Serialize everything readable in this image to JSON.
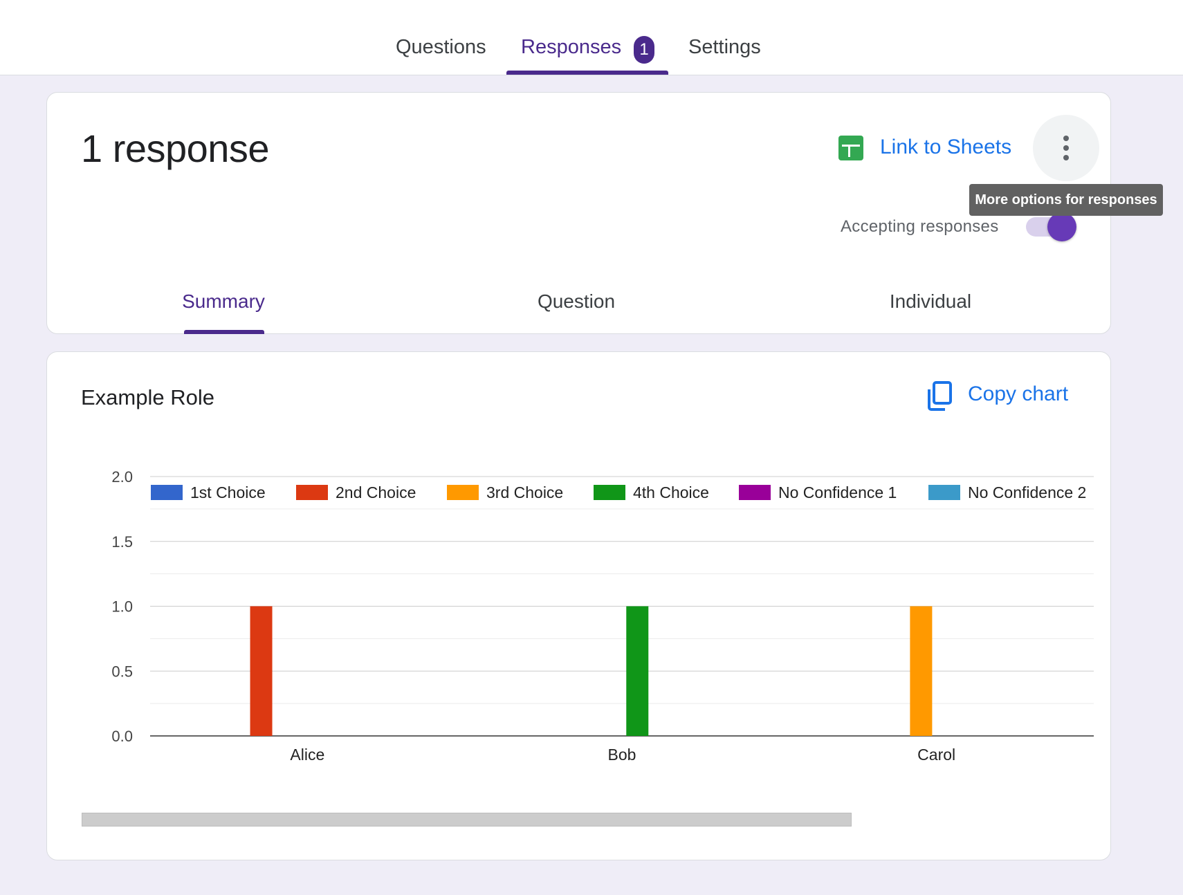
{
  "top_tabs": [
    {
      "label": "Questions"
    },
    {
      "label": "Responses",
      "badge": "1"
    },
    {
      "label": "Settings"
    }
  ],
  "summary": {
    "title": "1 response",
    "link_sheets": "Link to Sheets",
    "more_icon": "more-vert-icon",
    "tooltip": "More options for responses",
    "accepting_label": "Accepting responses",
    "accepting_on": true,
    "sub_tabs": [
      {
        "label": "Summary"
      },
      {
        "label": "Question"
      },
      {
        "label": "Individual"
      }
    ]
  },
  "chart_card": {
    "title": "Example Role",
    "copy_label": "Copy chart",
    "copy_icon": "copy-icon"
  },
  "colors": {
    "accent": "#4a2a8c",
    "link": "#1a73e8",
    "sheets_green": "#33a852",
    "toggle": "#673ab7"
  },
  "chart_data": {
    "type": "bar",
    "categories": [
      "Alice",
      "Bob",
      "Carol"
    ],
    "series": [
      {
        "name": "1st Choice",
        "color": "#3366cc",
        "values": [
          0,
          0,
          0
        ]
      },
      {
        "name": "2nd Choice",
        "color": "#dc3912",
        "values": [
          1,
          0,
          0
        ]
      },
      {
        "name": "3rd Choice",
        "color": "#ff9900",
        "values": [
          0,
          0,
          1
        ]
      },
      {
        "name": "4th Choice",
        "color": "#109618",
        "values": [
          0,
          1,
          0
        ]
      },
      {
        "name": "No Confidence 1",
        "color": "#990099",
        "values": [
          0,
          0,
          0
        ]
      },
      {
        "name": "No Confidence 2",
        "color": "#3b9ac9",
        "values": [
          0,
          0,
          0
        ]
      }
    ],
    "yticks": [
      "0.0",
      "0.5",
      "1.0",
      "1.5",
      "2.0"
    ],
    "ylim": [
      0,
      2
    ],
    "grid": true,
    "legend": "top"
  }
}
